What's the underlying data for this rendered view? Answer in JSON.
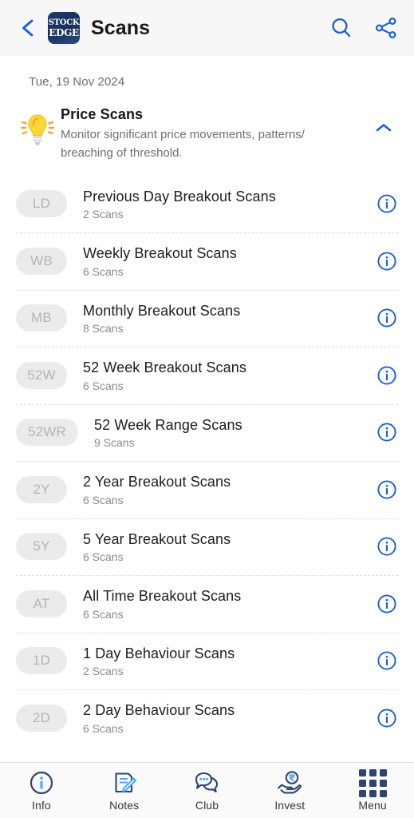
{
  "header": {
    "back_icon": "chevron-left-icon",
    "logo_line1": "STOCK",
    "logo_line2": "EDGE",
    "title": "Scans",
    "search_icon": "search-icon",
    "share_icon": "share-icon"
  },
  "content": {
    "date": "Tue, 19 Nov 2024",
    "section": {
      "icon": "lightbulb-icon",
      "title": "Price Scans",
      "subtitle": "Monitor significant price movements, patterns/ breaching of threshold.",
      "collapse_icon": "chevron-up-icon"
    },
    "rows": [
      {
        "badge": "LD",
        "title": "Previous Day Breakout Scans",
        "count": "2 Scans",
        "info_icon": "info-circle-icon"
      },
      {
        "badge": "WB",
        "title": "Weekly Breakout Scans",
        "count": "6 Scans",
        "info_icon": "info-circle-icon"
      },
      {
        "badge": "MB",
        "title": "Monthly Breakout Scans",
        "count": "8 Scans",
        "info_icon": "info-circle-icon"
      },
      {
        "badge": "52W",
        "title": "52 Week Breakout Scans",
        "count": "6 Scans",
        "info_icon": "info-circle-icon"
      },
      {
        "badge": "52WR",
        "title": "52 Week Range Scans",
        "count": "9 Scans",
        "info_icon": "info-circle-icon"
      },
      {
        "badge": "2Y",
        "title": "2 Year Breakout Scans",
        "count": "6 Scans",
        "info_icon": "info-circle-icon"
      },
      {
        "badge": "5Y",
        "title": "5 Year Breakout Scans",
        "count": "6 Scans",
        "info_icon": "info-circle-icon"
      },
      {
        "badge": "AT",
        "title": "All Time Breakout Scans",
        "count": "6 Scans",
        "info_icon": "info-circle-icon"
      },
      {
        "badge": "1D",
        "title": "1 Day Behaviour Scans",
        "count": "2 Scans",
        "info_icon": "info-circle-icon"
      },
      {
        "badge": "2D",
        "title": "2 Day Behaviour Scans",
        "count": "6 Scans",
        "info_icon": "info-circle-icon"
      }
    ]
  },
  "bottom_nav": [
    {
      "label": "Info",
      "icon": "info-circle-icon"
    },
    {
      "label": "Notes",
      "icon": "note-pencil-icon"
    },
    {
      "label": "Club",
      "icon": "chat-bubbles-icon"
    },
    {
      "label": "Invest",
      "icon": "hand-rupee-coin-icon"
    },
    {
      "label": "Menu",
      "icon": "grid-menu-icon"
    }
  ],
  "colors": {
    "accent_blue": "#1a5fd0",
    "navy": "#2e4570",
    "light_blue": "#4da6ff",
    "bulb_yellow": "#ffd633",
    "bulb_ray_orange": "#f2a03d",
    "badge_bg": "#ebebeb",
    "badge_text": "#b4b4b4",
    "header_bg": "#f7f7f7"
  }
}
